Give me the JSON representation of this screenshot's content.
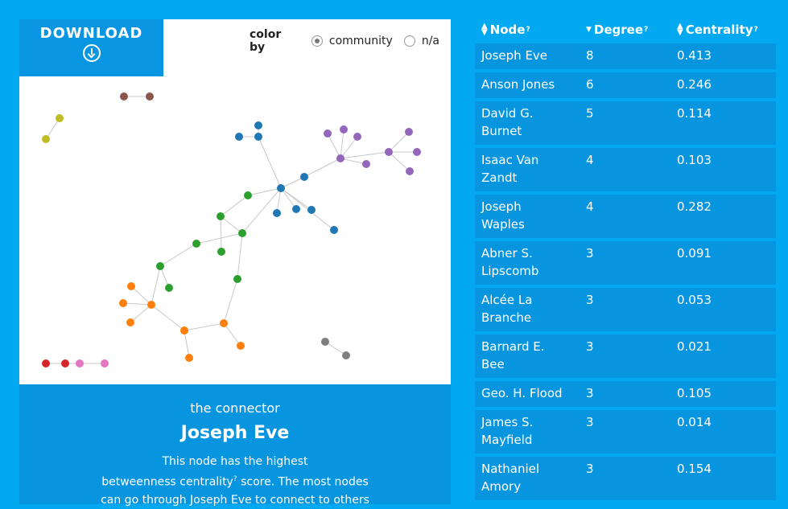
{
  "download": {
    "label": "DOWNLOAD"
  },
  "color_by": {
    "label": "color by",
    "options": [
      "community",
      "n/a"
    ],
    "selected": "community"
  },
  "info": {
    "subtitle": "the connector",
    "name": "Joseph Eve",
    "description_1": "This node has the highest",
    "description_2": "betweenness centrality",
    "description_3": "score. The most nodes",
    "description_4": "can go through Joseph Eve to connect to others",
    "help": "?"
  },
  "table": {
    "headers": [
      {
        "label": "Node",
        "sort": "both"
      },
      {
        "label": "Degree",
        "sort": "desc"
      },
      {
        "label": "Centrality",
        "sort": "both"
      }
    ],
    "help": "?",
    "rows": [
      {
        "node": "Joseph Eve",
        "degree": "8",
        "centrality": "0.413"
      },
      {
        "node": "Anson Jones",
        "degree": "6",
        "centrality": "0.246"
      },
      {
        "node": "David G. Burnet",
        "degree": "5",
        "centrality": "0.114"
      },
      {
        "node": "Isaac Van Zandt",
        "degree": "4",
        "centrality": "0.103"
      },
      {
        "node": "Joseph Waples",
        "degree": "4",
        "centrality": "0.282"
      },
      {
        "node": "Abner S. Lipscomb",
        "degree": "3",
        "centrality": "0.091"
      },
      {
        "node": "Alcée La Branche",
        "degree": "3",
        "centrality": "0.053"
      },
      {
        "node": "Barnard E. Bee",
        "degree": "3",
        "centrality": "0.021"
      },
      {
        "node": "Geo. H. Flood",
        "degree": "3",
        "centrality": "0.105"
      },
      {
        "node": "James S. Mayfield",
        "degree": "3",
        "centrality": "0.014"
      },
      {
        "node": "Nathaniel Amory",
        "degree": "3",
        "centrality": "0.154"
      }
    ]
  },
  "community_colors": {
    "blue": "#1f77b4",
    "purple": "#9467bd",
    "green": "#2ca02c",
    "orange": "#ff7f0e",
    "brown": "#8c564b",
    "olive": "#bcbd22",
    "red": "#d62728",
    "pink": "#e377c2",
    "gray": "#7f7f7f"
  }
}
